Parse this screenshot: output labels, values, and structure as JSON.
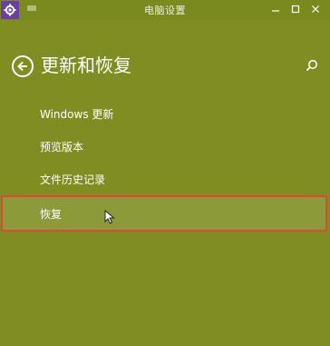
{
  "window": {
    "title": "电脑设置"
  },
  "titlebar": {
    "app_icon": "gear-icon",
    "menu_icon": "menu-icon",
    "minimize_icon": "minimize-icon",
    "maximize_icon": "maximize-icon",
    "close_icon": "close-icon"
  },
  "header": {
    "title": "更新和恢复",
    "back_icon": "back-arrow-icon",
    "search_icon": "search-icon"
  },
  "nav": {
    "items": [
      {
        "label": "Windows 更新"
      },
      {
        "label": "预览版本"
      },
      {
        "label": "文件历史记录"
      },
      {
        "label": "恢复",
        "selected": true
      }
    ]
  },
  "colors": {
    "background": "#7f8d22",
    "selected_background": "#8d9a3a",
    "highlight_border": "#e0473a",
    "app_icon_background": "#6b3fa3"
  }
}
